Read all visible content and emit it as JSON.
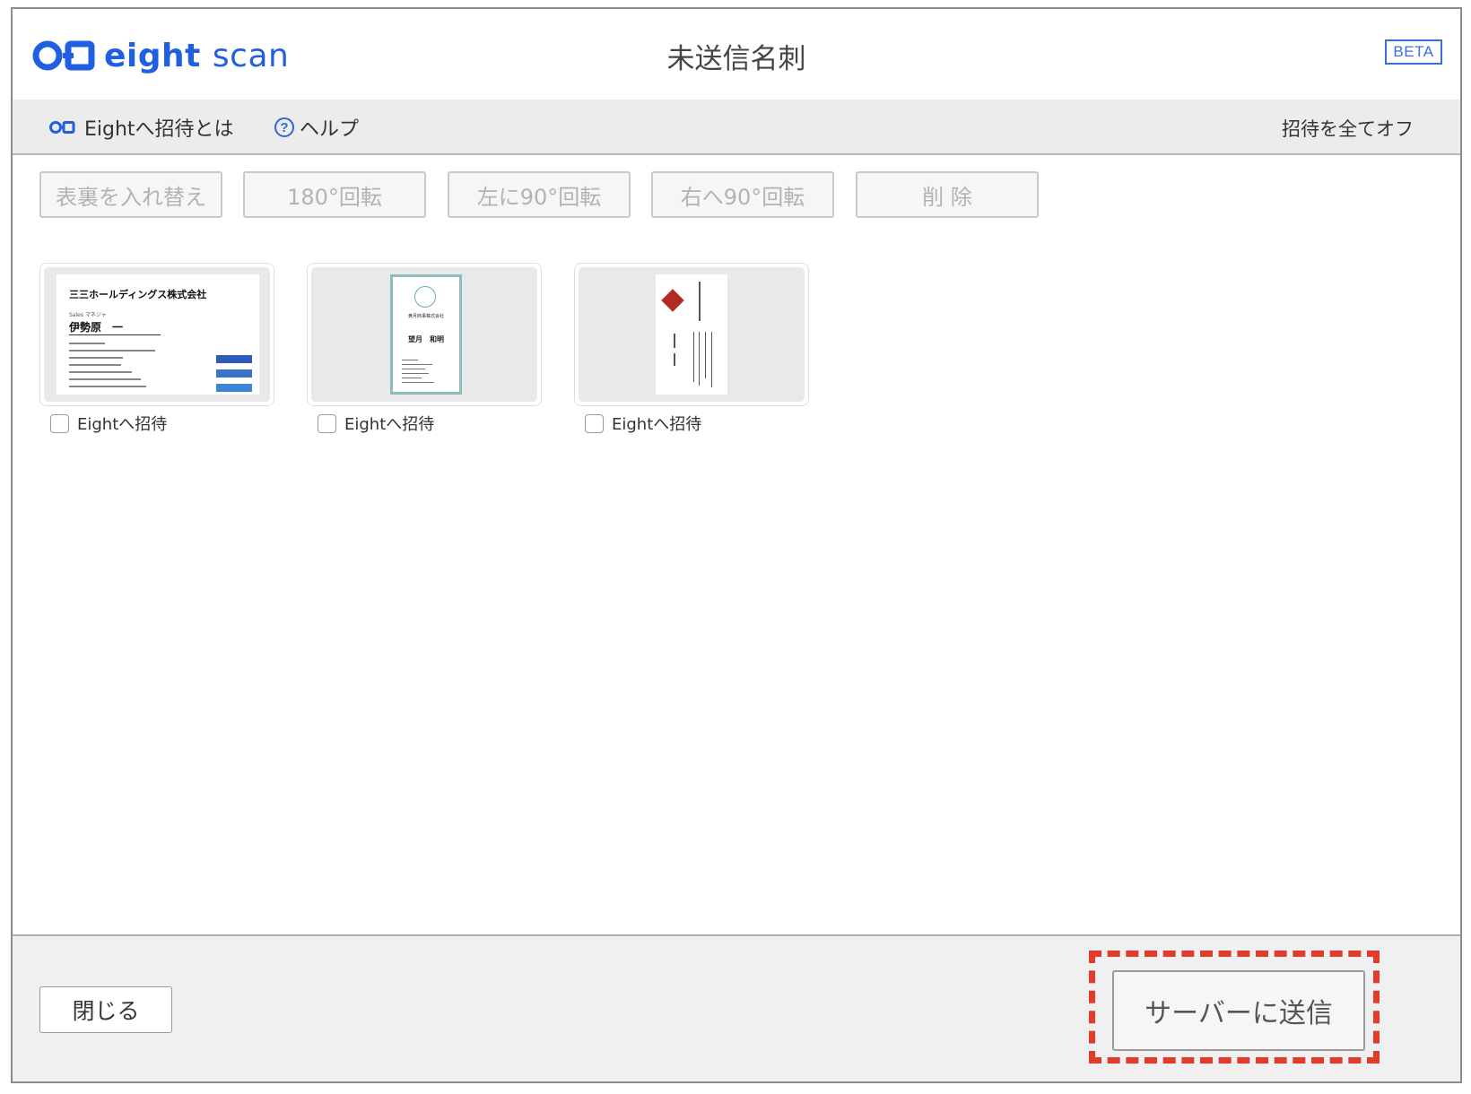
{
  "header": {
    "brand_bold": "eight",
    "brand_light": "scan",
    "title": "未送信名刺",
    "beta_badge": "BETA"
  },
  "toolbar": {
    "invite_about": "Eightへ招待とは",
    "help_icon_glyph": "?",
    "help": "ヘルプ",
    "all_off": "招待を全てオフ"
  },
  "actions": {
    "swap": "表裏を入れ替え",
    "rotate180": "180°回転",
    "rotate_left": "左に90°回転",
    "rotate_right": "右へ90°回転",
    "delete": "削 除"
  },
  "cards": [
    {
      "invite_label": "Eightへ招待",
      "invite_checked": false,
      "company": "三三ホールディングス株式会社",
      "role": "Sales マネジャ",
      "name": "伊勢原　一",
      "stripe_colors": [
        "#2d5db8",
        "#3a73c4",
        "#3b86d6"
      ]
    },
    {
      "invite_label": "Eightへ招待",
      "invite_checked": false,
      "company": "黄月商事株式会社",
      "name": "望月　和明",
      "border_color": "#8dbcbc"
    },
    {
      "invite_label": "Eightへ招待",
      "invite_checked": false,
      "logo_color": "#b32a22"
    }
  ],
  "footer": {
    "close": "閉じる",
    "send": "サーバーに送信",
    "highlight_color": "#e23b2b"
  },
  "colors": {
    "brand_blue": "#1f5fe0",
    "toolbar_bg": "#ececec",
    "disabled_text": "#b3b3b3"
  }
}
